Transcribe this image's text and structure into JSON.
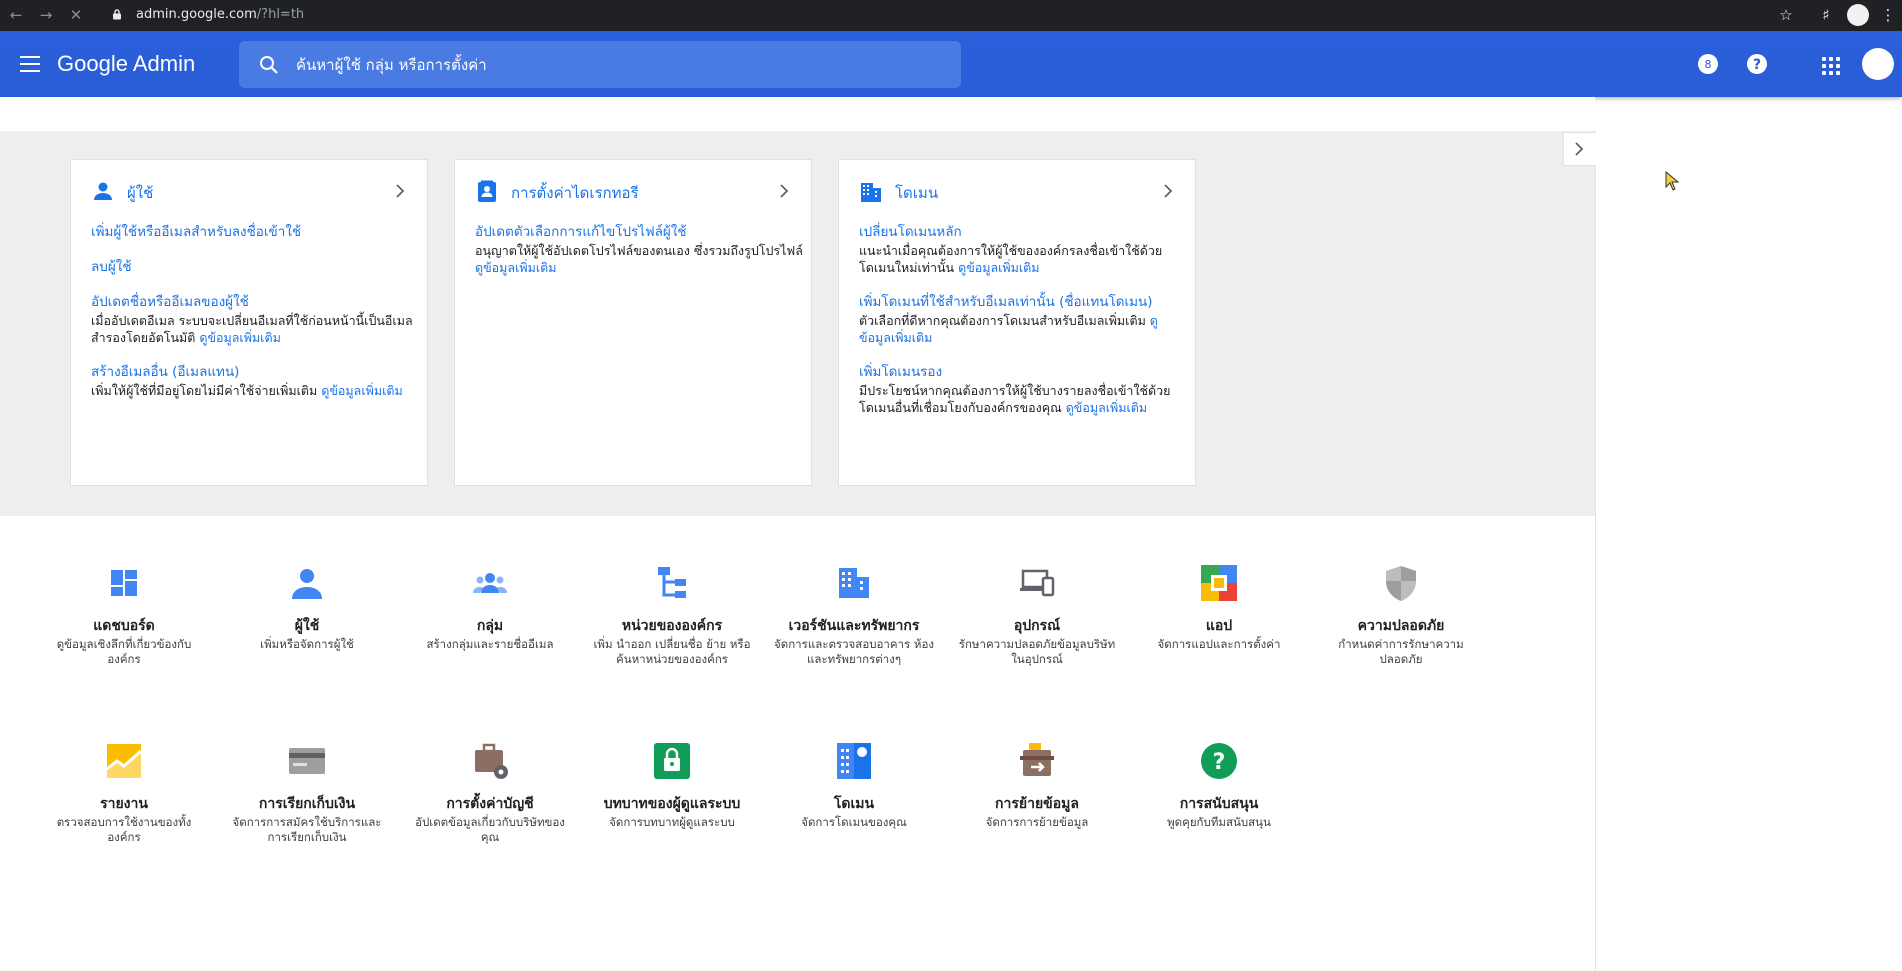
{
  "browser": {
    "url_host": "admin.google.com",
    "url_path": "/?hl=th"
  },
  "header": {
    "brand": "Google Admin",
    "search_placeholder": "ค้นหาผู้ใช้ กลุ่ม หรือการตั้งค่า",
    "notification_badge": "8"
  },
  "cards": [
    {
      "title": "ผู้ใช้",
      "items": [
        {
          "link": "เพิ่มผู้ใช้หรืออีเมลสำหรับลงชื่อเข้าใช้",
          "desc": "",
          "more": ""
        },
        {
          "link": "ลบผู้ใช้",
          "desc": "",
          "more": ""
        },
        {
          "link": "อัปเดตชื่อหรืออีเมลของผู้ใช้",
          "desc": "เมื่ออัปเดตอีเมล ระบบจะเปลี่ยนอีเมลที่ใช้ก่อนหน้านี้เป็นอีเมลสำรองโดยอัตโนมัติ",
          "more": "ดูข้อมูลเพิ่มเติม"
        },
        {
          "link": "สร้างอีเมลอื่น (อีเมลแทน)",
          "desc": "เพิ่มให้ผู้ใช้ที่มีอยู่โดยไม่มีค่าใช้จ่ายเพิ่มเติม",
          "more": "ดูข้อมูลเพิ่มเติม"
        }
      ]
    },
    {
      "title": "การตั้งค่าไดเรกทอรี",
      "items": [
        {
          "link": "อัปเดตตัวเลือกการแก้ไขโปรไฟล์ผู้ใช้",
          "desc": "อนุญาตให้ผู้ใช้อัปเดตโปรไฟล์ของตนเอง ซึ่งรวมถึงรูปโปรไฟล์",
          "more": "ดูข้อมูลเพิ่มเติม"
        }
      ]
    },
    {
      "title": "โดเมน",
      "items": [
        {
          "link": "เปลี่ยนโดเมนหลัก",
          "desc": "แนะนำเมื่อคุณต้องการให้ผู้ใช้ขององค์กรลงชื่อเข้าใช้ด้วยโดเมนใหม่เท่านั้น",
          "more": "ดูข้อมูลเพิ่มเติม"
        },
        {
          "link": "เพิ่มโดเมนที่ใช้สำหรับอีเมลเท่านั้น (ชื่อแทนโดเมน)",
          "desc": "ตัวเลือกที่ดีหากคุณต้องการโดเมนสำหรับอีเมลเพิ่มเติม",
          "more": "ดูข้อมูลเพิ่มเติม"
        },
        {
          "link": "เพิ่มโดเมนรอง",
          "desc": "มีประโยชน์หากคุณต้องการให้ผู้ใช้บางรายลงชื่อเข้าใช้ด้วยโดเมนอื่นที่เชื่อมโยงกับองค์กรของคุณ",
          "more": "ดูข้อมูลเพิ่มเติม"
        }
      ]
    }
  ],
  "tiles": [
    {
      "title": "แดชบอร์ด",
      "desc": "ดูข้อมูลเชิงลึกที่เกี่ยวข้องกับองค์กร",
      "icon": "dashboard-icon"
    },
    {
      "title": "ผู้ใช้",
      "desc": "เพิ่มหรือจัดการผู้ใช้",
      "icon": "user-icon"
    },
    {
      "title": "กลุ่ม",
      "desc": "สร้างกลุ่มและรายชื่ออีเมล",
      "icon": "groups-icon"
    },
    {
      "title": "หน่วยขององค์กร",
      "desc": "เพิ่ม นำออก เปลี่ยนชื่อ ย้าย หรือค้นหาหน่วยขององค์กร",
      "icon": "org-units-icon"
    },
    {
      "title": "เวอร์ชันและทรัพยากร",
      "desc": "จัดการและตรวจสอบอาคาร ห้อง และทรัพยากรต่างๆ",
      "icon": "buildings-icon"
    },
    {
      "title": "อุปกรณ์",
      "desc": "รักษาความปลอดภัยข้อมูลบริษัทในอุปกรณ์",
      "icon": "devices-icon"
    },
    {
      "title": "แอป",
      "desc": "จัดการแอปและการตั้งค่า",
      "icon": "apps-icon"
    },
    {
      "title": "ความปลอดภัย",
      "desc": "กำหนดค่าการรักษาความปลอดภัย",
      "icon": "security-shield-icon"
    },
    {
      "title": "รายงาน",
      "desc": "ตรวจสอบการใช้งานของทั้งองค์กร",
      "icon": "reports-icon"
    },
    {
      "title": "การเรียกเก็บเงิน",
      "desc": "จัดการการสมัครใช้บริการและการเรียกเก็บเงิน",
      "icon": "billing-icon"
    },
    {
      "title": "การตั้งค่าบัญชี",
      "desc": "อัปเดตข้อมูลเกี่ยวกับบริษัทของคุณ",
      "icon": "account-settings-icon"
    },
    {
      "title": "บทบาทของผู้ดูแลระบบ",
      "desc": "จัดการบทบาทผู้ดูแลระบบ",
      "icon": "admin-roles-icon"
    },
    {
      "title": "โดเมน",
      "desc": "จัดการโดเมนของคุณ",
      "icon": "domains-icon"
    },
    {
      "title": "การย้ายข้อมูล",
      "desc": "จัดการการย้ายข้อมูล",
      "icon": "data-migration-icon"
    },
    {
      "title": "การสนับสนุน",
      "desc": "พูดคุยกับทีมสนับสนุน",
      "icon": "support-icon"
    }
  ]
}
